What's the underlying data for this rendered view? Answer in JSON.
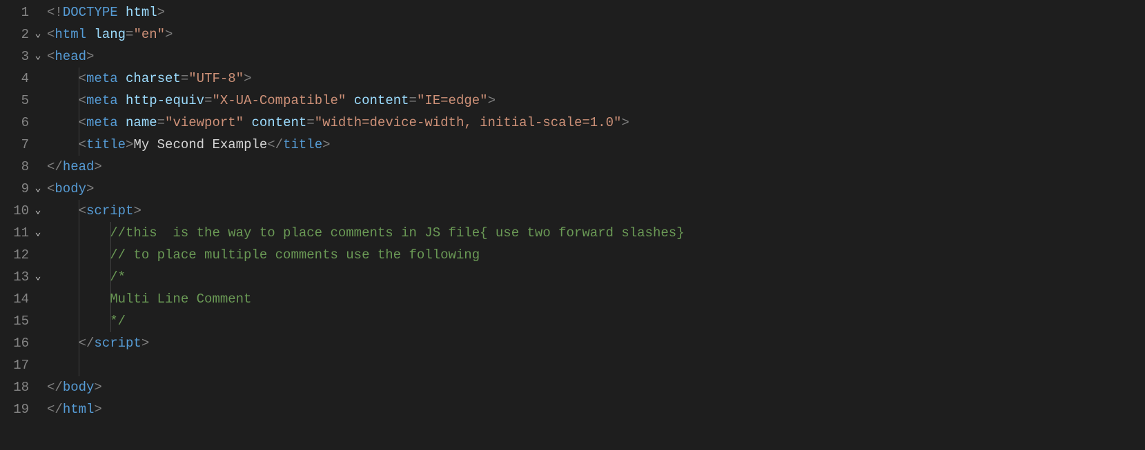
{
  "editor": {
    "lines": [
      {
        "num": "1",
        "fold": "",
        "indent": 0,
        "guides": [],
        "tokens": [
          {
            "cls": "p-brk",
            "t": "<!"
          },
          {
            "cls": "p-tag",
            "t": "DOCTYPE"
          },
          {
            "cls": "p-txt",
            "t": " "
          },
          {
            "cls": "p-attr",
            "t": "html"
          },
          {
            "cls": "p-brk",
            "t": ">"
          }
        ]
      },
      {
        "num": "2",
        "fold": "v",
        "indent": 0,
        "guides": [],
        "tokens": [
          {
            "cls": "p-brk",
            "t": "<"
          },
          {
            "cls": "p-tag",
            "t": "html"
          },
          {
            "cls": "p-txt",
            "t": " "
          },
          {
            "cls": "p-attr",
            "t": "lang"
          },
          {
            "cls": "p-brk",
            "t": "="
          },
          {
            "cls": "p-str",
            "t": "\"en\""
          },
          {
            "cls": "p-brk",
            "t": ">"
          }
        ]
      },
      {
        "num": "3",
        "fold": "v",
        "indent": 0,
        "guides": [],
        "tokens": [
          {
            "cls": "p-brk",
            "t": "<"
          },
          {
            "cls": "p-tag",
            "t": "head"
          },
          {
            "cls": "p-brk",
            "t": ">"
          }
        ]
      },
      {
        "num": "4",
        "fold": "",
        "indent": 1,
        "guides": [
          1
        ],
        "tokens": [
          {
            "cls": "p-brk",
            "t": "<"
          },
          {
            "cls": "p-tag",
            "t": "meta"
          },
          {
            "cls": "p-txt",
            "t": " "
          },
          {
            "cls": "p-attr",
            "t": "charset"
          },
          {
            "cls": "p-brk",
            "t": "="
          },
          {
            "cls": "p-str",
            "t": "\"UTF-8\""
          },
          {
            "cls": "p-brk",
            "t": ">"
          }
        ]
      },
      {
        "num": "5",
        "fold": "",
        "indent": 1,
        "guides": [
          1
        ],
        "tokens": [
          {
            "cls": "p-brk",
            "t": "<"
          },
          {
            "cls": "p-tag",
            "t": "meta"
          },
          {
            "cls": "p-txt",
            "t": " "
          },
          {
            "cls": "p-attr",
            "t": "http-equiv"
          },
          {
            "cls": "p-brk",
            "t": "="
          },
          {
            "cls": "p-str",
            "t": "\"X-UA-Compatible\""
          },
          {
            "cls": "p-txt",
            "t": " "
          },
          {
            "cls": "p-attr",
            "t": "content"
          },
          {
            "cls": "p-brk",
            "t": "="
          },
          {
            "cls": "p-str",
            "t": "\"IE=edge\""
          },
          {
            "cls": "p-brk",
            "t": ">"
          }
        ]
      },
      {
        "num": "6",
        "fold": "",
        "indent": 1,
        "guides": [
          1
        ],
        "tokens": [
          {
            "cls": "p-brk",
            "t": "<"
          },
          {
            "cls": "p-tag",
            "t": "meta"
          },
          {
            "cls": "p-txt",
            "t": " "
          },
          {
            "cls": "p-attr",
            "t": "name"
          },
          {
            "cls": "p-brk",
            "t": "="
          },
          {
            "cls": "p-str",
            "t": "\"viewport\""
          },
          {
            "cls": "p-txt",
            "t": " "
          },
          {
            "cls": "p-attr",
            "t": "content"
          },
          {
            "cls": "p-brk",
            "t": "="
          },
          {
            "cls": "p-str",
            "t": "\"width=device-width, initial-scale=1.0\""
          },
          {
            "cls": "p-brk",
            "t": ">"
          }
        ]
      },
      {
        "num": "7",
        "fold": "",
        "indent": 1,
        "guides": [
          1
        ],
        "tokens": [
          {
            "cls": "p-brk",
            "t": "<"
          },
          {
            "cls": "p-tag",
            "t": "title"
          },
          {
            "cls": "p-brk",
            "t": ">"
          },
          {
            "cls": "p-txt",
            "t": "My Second Example"
          },
          {
            "cls": "p-brk",
            "t": "</"
          },
          {
            "cls": "p-tag",
            "t": "title"
          },
          {
            "cls": "p-brk",
            "t": ">"
          }
        ]
      },
      {
        "num": "8",
        "fold": "",
        "indent": 0,
        "guides": [],
        "tokens": [
          {
            "cls": "p-brk",
            "t": "</"
          },
          {
            "cls": "p-tag",
            "t": "head"
          },
          {
            "cls": "p-brk",
            "t": ">"
          }
        ]
      },
      {
        "num": "9",
        "fold": "v",
        "indent": 0,
        "guides": [],
        "tokens": [
          {
            "cls": "p-brk",
            "t": "<"
          },
          {
            "cls": "p-tag",
            "t": "body"
          },
          {
            "cls": "p-brk",
            "t": ">"
          }
        ]
      },
      {
        "num": "10",
        "fold": "v",
        "indent": 1,
        "guides": [
          1
        ],
        "tokens": [
          {
            "cls": "p-brk",
            "t": "<"
          },
          {
            "cls": "p-tag",
            "t": "script"
          },
          {
            "cls": "p-brk",
            "t": ">"
          }
        ]
      },
      {
        "num": "11",
        "fold": "v",
        "indent": 2,
        "guides": [
          1,
          2
        ],
        "tokens": [
          {
            "cls": "p-cmt",
            "t": "//this  is the way to place comments in JS file{ use two forward slashes}"
          }
        ]
      },
      {
        "num": "12",
        "fold": "",
        "indent": 2,
        "guides": [
          1,
          2
        ],
        "tokens": [
          {
            "cls": "p-cmt",
            "t": "// to place multiple comments use the following"
          }
        ]
      },
      {
        "num": "13",
        "fold": "v",
        "indent": 2,
        "guides": [
          1,
          2
        ],
        "tokens": [
          {
            "cls": "p-cmt",
            "t": "/*"
          }
        ]
      },
      {
        "num": "14",
        "fold": "",
        "indent": 2,
        "guides": [
          1,
          2
        ],
        "tokens": [
          {
            "cls": "p-cmt",
            "t": "Multi Line Comment"
          }
        ]
      },
      {
        "num": "15",
        "fold": "",
        "indent": 2,
        "guides": [
          1,
          2
        ],
        "tokens": [
          {
            "cls": "p-cmt",
            "t": "*/"
          }
        ]
      },
      {
        "num": "16",
        "fold": "",
        "indent": 1,
        "guides": [
          1
        ],
        "tokens": [
          {
            "cls": "p-brk",
            "t": "</"
          },
          {
            "cls": "p-tag",
            "t": "script"
          },
          {
            "cls": "p-brk",
            "t": ">"
          }
        ]
      },
      {
        "num": "17",
        "fold": "",
        "indent": 1,
        "guides": [
          1
        ],
        "tokens": []
      },
      {
        "num": "18",
        "fold": "",
        "indent": 0,
        "guides": [],
        "tokens": [
          {
            "cls": "p-brk",
            "t": "</"
          },
          {
            "cls": "p-tag",
            "t": "body"
          },
          {
            "cls": "p-brk",
            "t": ">"
          }
        ]
      },
      {
        "num": "19",
        "fold": "",
        "indent": 0,
        "guides": [],
        "tokens": [
          {
            "cls": "p-brk",
            "t": "</"
          },
          {
            "cls": "p-tag",
            "t": "html"
          },
          {
            "cls": "p-brk",
            "t": ">"
          }
        ]
      }
    ],
    "indentUnit": "    ",
    "foldGlyph": "⌄"
  }
}
